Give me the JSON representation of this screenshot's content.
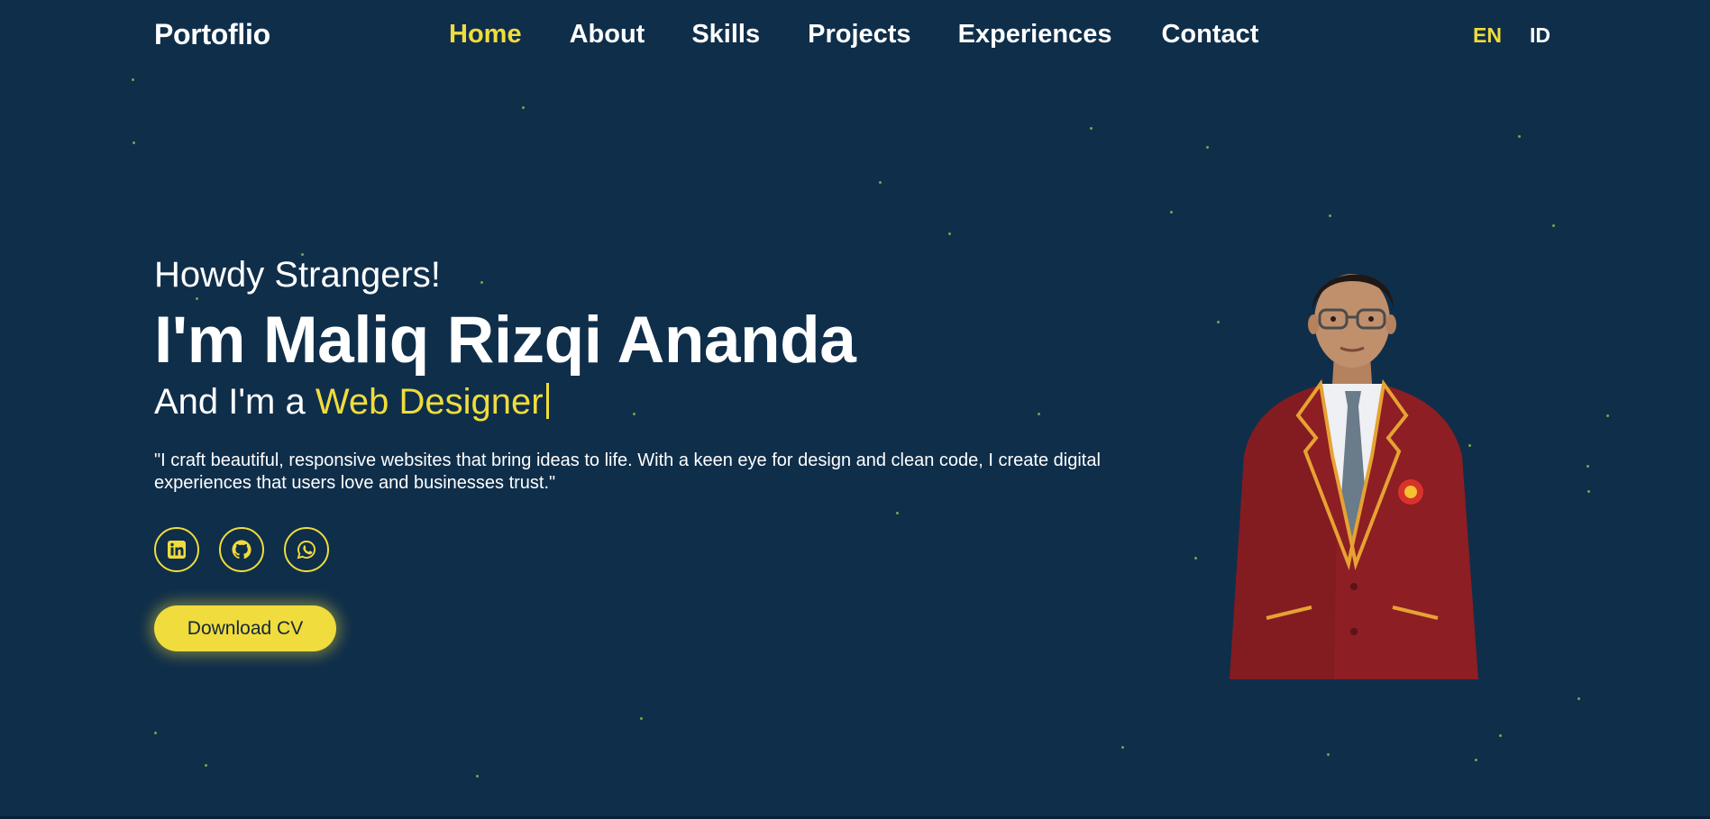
{
  "nav": {
    "brand": "Portoflio",
    "links": [
      "Home",
      "About",
      "Skills",
      "Projects",
      "Experiences",
      "Contact"
    ],
    "active_link": "Home",
    "languages": [
      "EN",
      "ID"
    ],
    "active_language": "EN"
  },
  "hero": {
    "greeting": "Howdy Strangers!",
    "name": "I'm Maliq Rizqi Ananda",
    "role_prefix": "And I'm a ",
    "role": "Web Designer",
    "tagline": "\"I craft beautiful, responsive websites that bring ideas to life. With a keen eye for design and clean code, I create digital experiences that users love and businesses trust.\"",
    "socials": [
      {
        "name": "linkedin",
        "icon": "linkedin-icon"
      },
      {
        "name": "github",
        "icon": "github-icon"
      },
      {
        "name": "whatsapp",
        "icon": "whatsapp-icon"
      }
    ],
    "download_label": "Download CV"
  },
  "colors": {
    "background": "#0f2e4a",
    "accent": "#f0dc3c",
    "text": "#ffffff",
    "star": "#7fbf4a"
  }
}
